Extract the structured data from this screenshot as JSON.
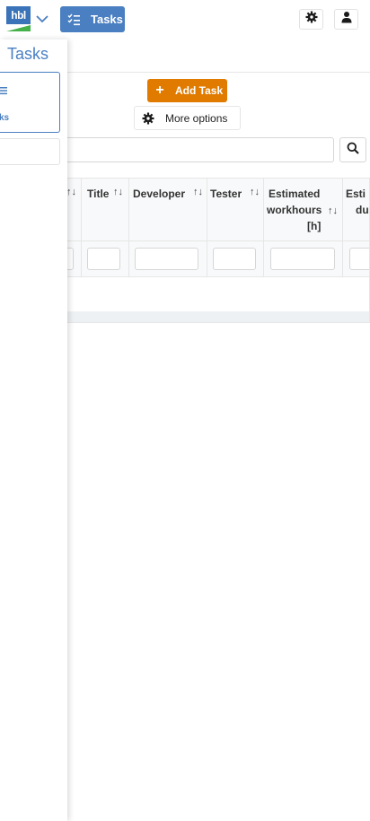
{
  "header": {
    "logo_text": "hbl",
    "module_label": "Tasks"
  },
  "drawer": {
    "title": "Tasks",
    "card_label": "ks"
  },
  "actions": {
    "add_label": "Add Task",
    "more_label": "More options"
  },
  "search": {
    "placeholder": "",
    "value": ""
  },
  "table": {
    "columns": [
      {
        "label": "",
        "sortable": true
      },
      {
        "label": "Title",
        "sortable": true
      },
      {
        "label": "Developer",
        "sortable": true
      },
      {
        "label": "Tester",
        "sortable": true
      },
      {
        "label": "Estimated workhours [h]",
        "line1": "Estimated",
        "line2": "workhours",
        "line3": "[h]",
        "sortable": true
      },
      {
        "label": "Esti du",
        "line1": "Esti",
        "line2": "du",
        "sortable": false
      }
    ],
    "sort_glyph": "↑↓"
  },
  "colors": {
    "primary": "#4a7fc1",
    "accent": "#e07b00",
    "logo_green": "#46b04a"
  }
}
